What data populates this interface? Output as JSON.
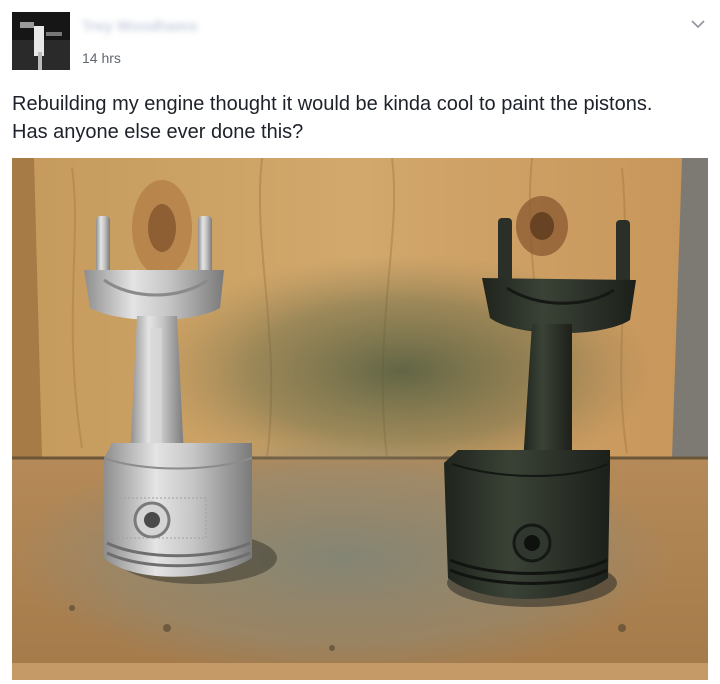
{
  "post": {
    "author_name": "Trey Woodhams",
    "timestamp": "14 hrs",
    "text_lines": [
      "Rebuilding my engine thought it would be kinda cool to paint the pistons.",
      "Has anyone else ever done this?"
    ]
  },
  "icons": {
    "options": "chevron-down-icon"
  },
  "colors": {
    "text": "#1d2129",
    "meta": "#616770",
    "wood": "#c99a5a",
    "silver_piston": "#c8c8c8",
    "painted_piston": "#2c322a"
  }
}
